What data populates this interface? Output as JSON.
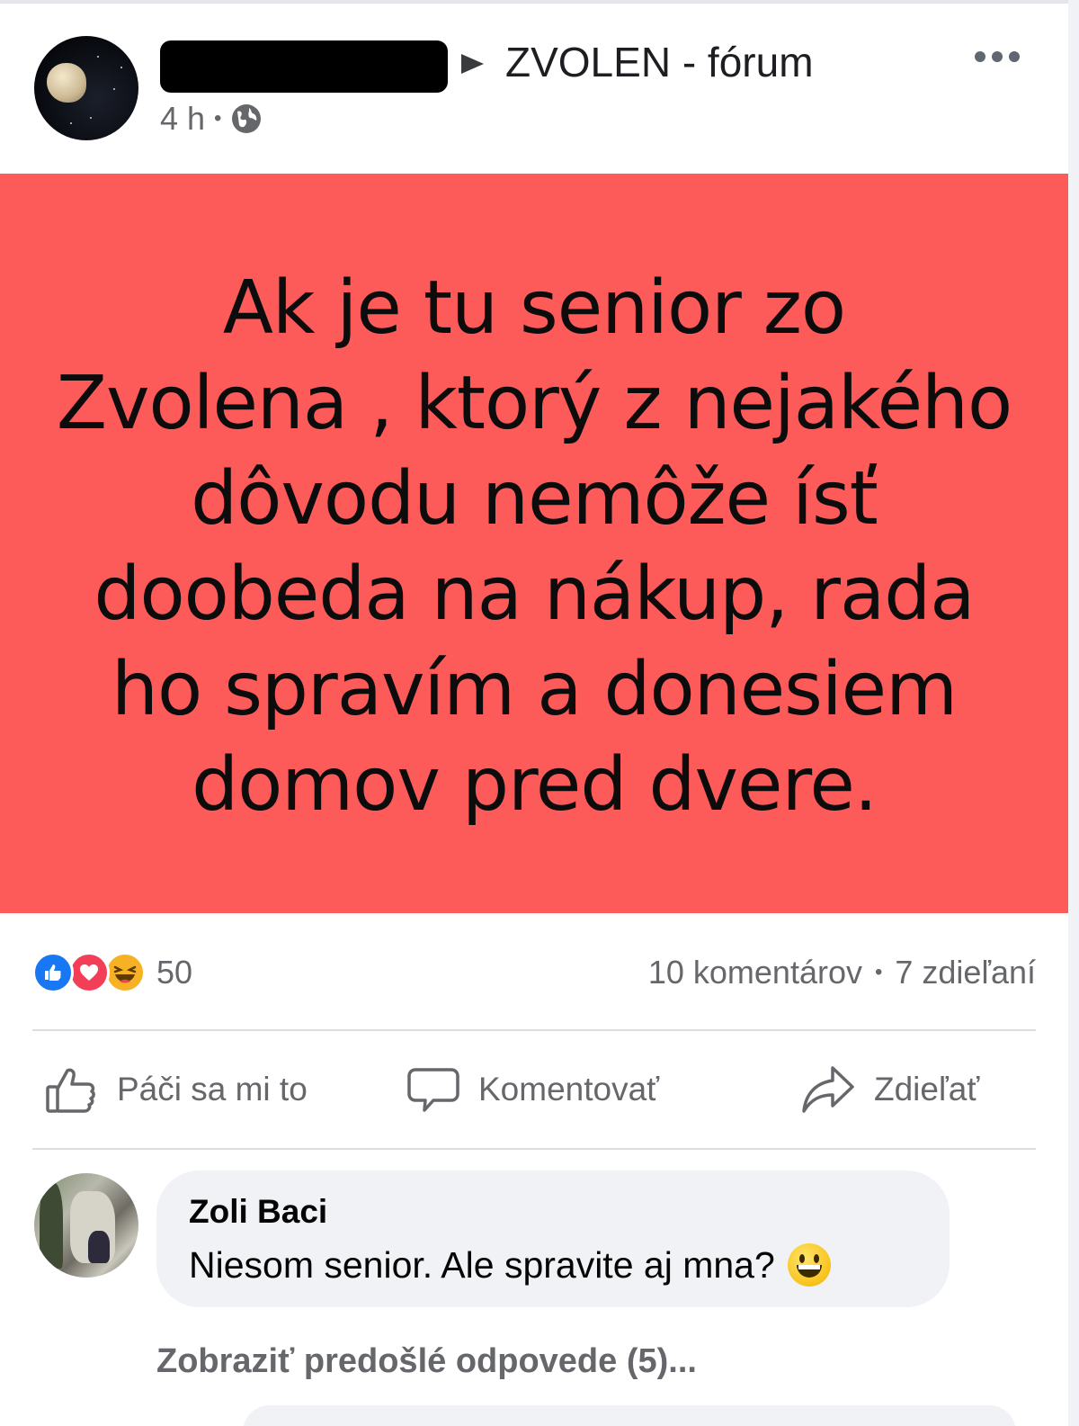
{
  "post": {
    "group_name": "ZVOLEN - fórum",
    "time": "4 h",
    "separator": "•",
    "privacy_icon": "globe-icon",
    "background_color": "#fd5a5a",
    "text_lines": [
      "Ak je tu senior zo",
      "Zvolena , ktorý z nejakého",
      "dôvodu nemôže ísť",
      "doobeda na nákup, rada",
      "ho spravím a donesiem",
      "domov pred dvere."
    ]
  },
  "engagement": {
    "reactions": [
      "like-icon",
      "love-icon",
      "haha-icon"
    ],
    "reaction_count": "50",
    "comments": "10 komentárov",
    "separator": "•",
    "shares": "7 zdieľaní"
  },
  "actions": {
    "like": "Páči sa mi to",
    "comment": "Komentovať",
    "share": "Zdieľať"
  },
  "comment": {
    "author": "Zoli Baci",
    "text": "Niesom senior. Ale spravite aj mna?",
    "emoji": "grinning-face-icon"
  },
  "replies": {
    "label": "Zobraziť predošlé odpovede (5)..."
  },
  "colors": {
    "accent_blue": "#1877f2",
    "love_red": "#f33e58",
    "haha_yellow": "#f7b125",
    "muted_text": "#65676b"
  }
}
